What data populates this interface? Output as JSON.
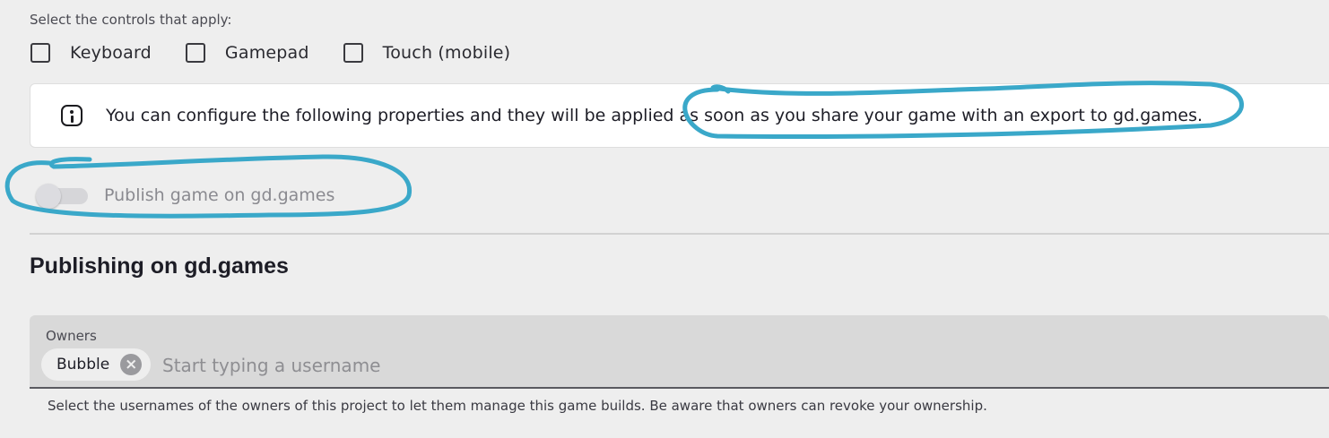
{
  "controls": {
    "label": "Select the controls that apply:",
    "options": [
      {
        "label": "Keyboard",
        "checked": false
      },
      {
        "label": "Gamepad",
        "checked": false
      },
      {
        "label": "Touch (mobile)",
        "checked": false
      }
    ]
  },
  "info": {
    "icon": "info-icon",
    "text": "You can configure the following properties and they will be applied as soon as you share your game with an export to gd.games."
  },
  "publish_toggle": {
    "label": "Publish game on gd.games",
    "enabled": false,
    "disabled": true
  },
  "publishing_section": {
    "title": "Publishing on gd.games",
    "owners_field": {
      "label": "Owners",
      "chips": [
        {
          "label": "Bubble"
        }
      ],
      "placeholder": "Start typing a username",
      "helper_text": "Select the usernames of the owners of this project to let them manage this game builds. Be aware that owners can revoke your ownership."
    }
  },
  "colors": {
    "background": "#eeeeee",
    "annotation_stroke": "#3aa8c9",
    "field_background": "#d9d9d9"
  }
}
